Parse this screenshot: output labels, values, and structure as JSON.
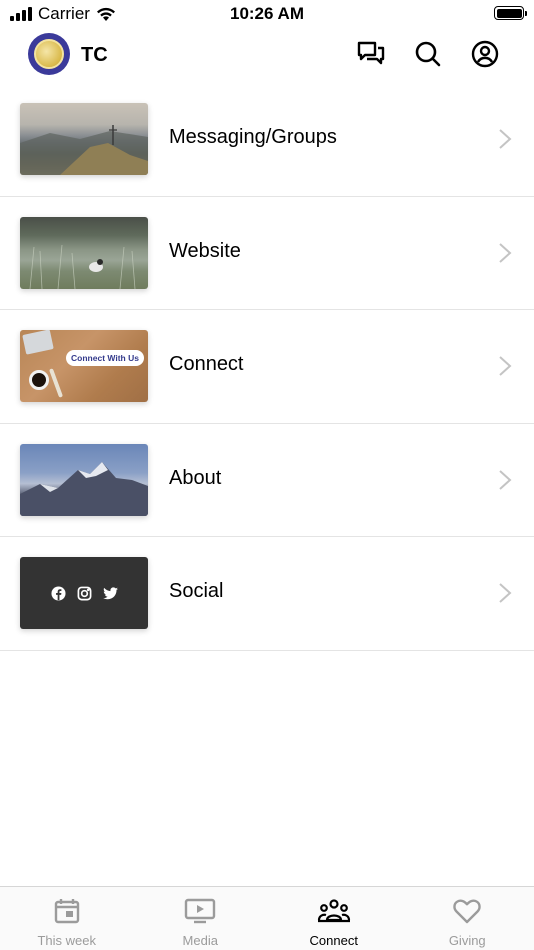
{
  "status_bar": {
    "carrier": "Carrier",
    "time": "10:26 AM"
  },
  "header": {
    "title": "TC"
  },
  "menu": {
    "items": [
      {
        "label": "Messaging/Groups"
      },
      {
        "label": "Website"
      },
      {
        "label": "Connect",
        "thumb_text": "Connect With Us"
      },
      {
        "label": "About"
      },
      {
        "label": "Social"
      }
    ]
  },
  "tab_bar": {
    "tabs": [
      {
        "label": "This week",
        "icon": "calendar-icon"
      },
      {
        "label": "Media",
        "icon": "tv-play-icon"
      },
      {
        "label": "Connect",
        "icon": "people-group-icon"
      },
      {
        "label": "Giving",
        "icon": "heart-icon"
      }
    ],
    "active": "Connect"
  },
  "colors": {
    "accent": "#000000",
    "inactive": "#9b9b9b",
    "logo": "#3b3a9a",
    "divider": "#e4e4e4"
  }
}
